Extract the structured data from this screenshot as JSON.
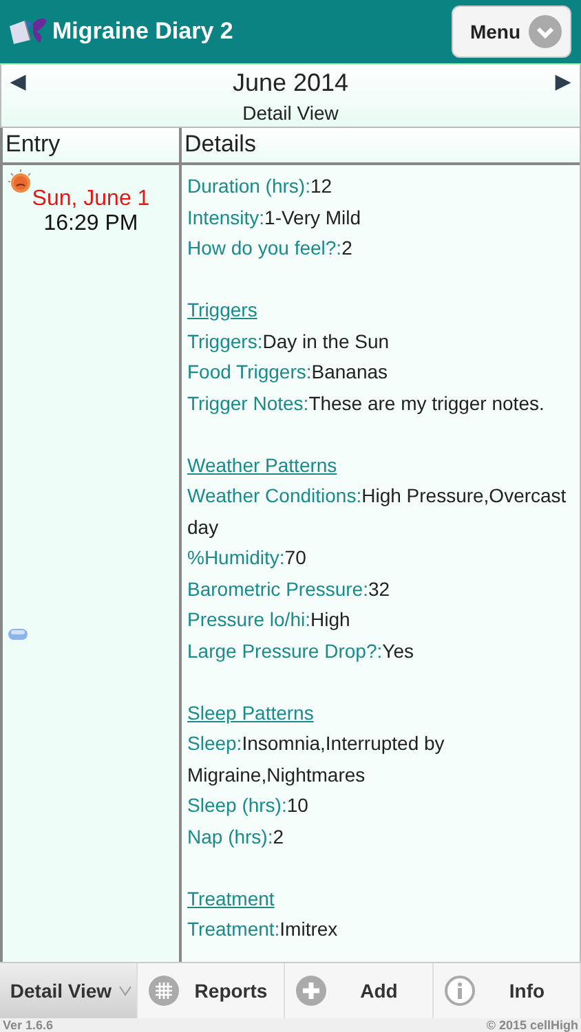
{
  "header": {
    "title": "Migraine Diary 2",
    "menu_button": "Menu"
  },
  "month_bar": {
    "month": "June 2014",
    "view": "Detail View",
    "prev": "◀",
    "next": "▶"
  },
  "table": {
    "columns": [
      "Entry",
      "Details"
    ],
    "entry": {
      "date": "Sun, June 1",
      "time": "16:29 PM"
    },
    "sections": [
      {
        "fields": [
          {
            "label": "Duration (hrs):",
            "value": "12"
          },
          {
            "label": "Intensity:",
            "value": "1-Very Mild"
          },
          {
            "label": "How do you feel?:",
            "value": "2"
          }
        ]
      },
      {
        "heading": "Triggers",
        "fields": [
          {
            "label": "Triggers:",
            "value": "Day in the Sun"
          },
          {
            "label": "Food Triggers:",
            "value": "Bananas"
          },
          {
            "label": "Trigger Notes:",
            "value": "These are my trigger notes."
          }
        ]
      },
      {
        "heading": "Weather Patterns",
        "fields": [
          {
            "label": "Weather Conditions:",
            "value": "High Pressure,Overcast day"
          },
          {
            "label": "%Humidity:",
            "value": "70"
          },
          {
            "label": "Barometric Pressure:",
            "value": "32"
          },
          {
            "label": "Pressure lo/hi:",
            "value": "High"
          },
          {
            "label": "Large Pressure Drop?:",
            "value": "Yes"
          }
        ]
      },
      {
        "heading": "Sleep Patterns",
        "fields": [
          {
            "label": "Sleep:",
            "value": "Insomnia,Interrupted by Migraine,Nightmares"
          },
          {
            "label": "Sleep (hrs):",
            "value": "10"
          },
          {
            "label": "Nap (hrs):",
            "value": "2"
          }
        ]
      },
      {
        "heading": "Treatment",
        "fields": [
          {
            "label": "Treatment:",
            "value": "Imitrex"
          }
        ]
      }
    ]
  },
  "tabs": [
    {
      "label": "Detail View",
      "kind": "dropdown",
      "selected": true
    },
    {
      "label": "Reports",
      "kind": "grid",
      "selected": false
    },
    {
      "label": "Add",
      "kind": "plus",
      "selected": false
    },
    {
      "label": "Info",
      "kind": "info",
      "selected": false
    }
  ],
  "footer": {
    "version": "Ver 1.6.6",
    "copyright": "© 2015 cellHigh"
  }
}
